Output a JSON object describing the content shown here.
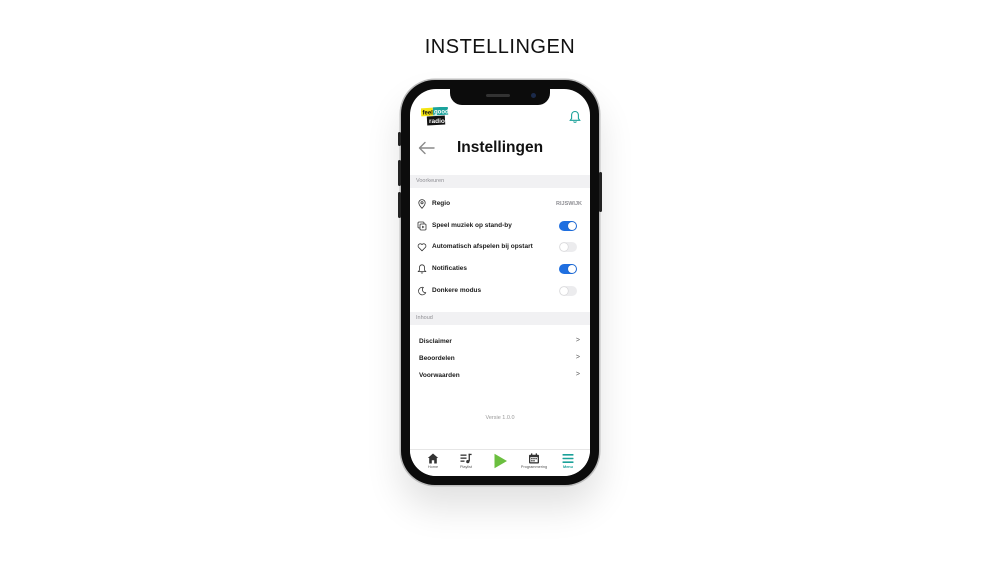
{
  "page": {
    "heading": "INSTELLINGEN"
  },
  "header": {
    "logo_alt": "feel good radio",
    "logo_words": [
      "feel",
      "good",
      "radio"
    ],
    "bell_icon": "bell-icon"
  },
  "screen": {
    "title": "Instellingen",
    "back_icon": "arrow-left-icon"
  },
  "preferences": {
    "section_label": "Voorkeuren",
    "items": [
      {
        "label": "Regio",
        "icon": "location-pin-icon",
        "value": "RIJSWIJK"
      },
      {
        "label": "Speel muziek op stand-by",
        "icon": "copy-play-icon",
        "toggle": true
      },
      {
        "label": "Automatisch afspelen bij opstart",
        "icon": "heart-icon",
        "toggle": false
      },
      {
        "label": "Notificaties",
        "icon": "bell-icon",
        "toggle": true
      },
      {
        "label": "Donkere modus",
        "icon": "moon-icon",
        "toggle": false
      }
    ]
  },
  "content": {
    "section_label": "Inhoud",
    "items": [
      {
        "label": "Disclaimer",
        "chevron": ">"
      },
      {
        "label": "Beoordelen",
        "chevron": ">"
      },
      {
        "label": "Voorwaarden",
        "chevron": ">"
      }
    ]
  },
  "version": "Versie 1.0.0",
  "tabbar": {
    "items": [
      {
        "label": "Home",
        "icon": "home-icon",
        "active": false
      },
      {
        "label": "Playlist",
        "icon": "playlist-icon",
        "active": false
      },
      {
        "label": "",
        "icon": "play-icon",
        "active": false
      },
      {
        "label": "Programmering",
        "icon": "calendar-icon",
        "active": false
      },
      {
        "label": "Menu",
        "icon": "menu-icon",
        "active": true
      }
    ]
  },
  "colors": {
    "toggle_on": "#1f6fe0",
    "accent": "#1aa199",
    "play": "#6bbf3f",
    "logo_yellow": "#f4e514",
    "logo_teal": "#1ba39c"
  }
}
